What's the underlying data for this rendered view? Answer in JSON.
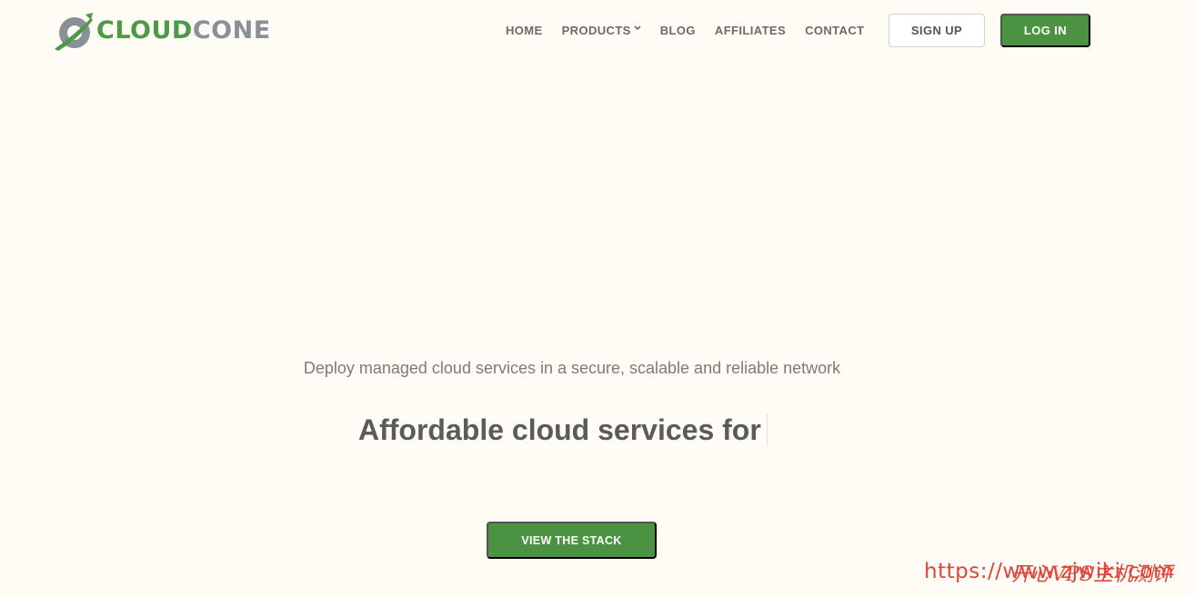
{
  "brand": {
    "logo_part1": "CLOUD",
    "logo_part2": "CONE",
    "logo_icon": "cloudcone-logo-icon",
    "green": "#4c9a45",
    "grey": "#8a9097"
  },
  "nav": {
    "items": [
      {
        "label": "HOME"
      },
      {
        "label": "PRODUCTS",
        "has_dropdown": true
      },
      {
        "label": "BLOG"
      },
      {
        "label": "AFFILIATES"
      },
      {
        "label": "CONTACT"
      }
    ]
  },
  "auth": {
    "signup_label": "SIGN UP",
    "login_label": "LOG IN"
  },
  "hero": {
    "subtitle": "Deploy managed cloud services in a secure, scalable and reliable network",
    "headline": "Affordable cloud services for",
    "cta_label": "VIEW THE STACK"
  },
  "watermark": {
    "url": "https://www.zjwiki.com",
    "chinese": "开心VPS主机测评",
    "color": "#e0453a"
  }
}
